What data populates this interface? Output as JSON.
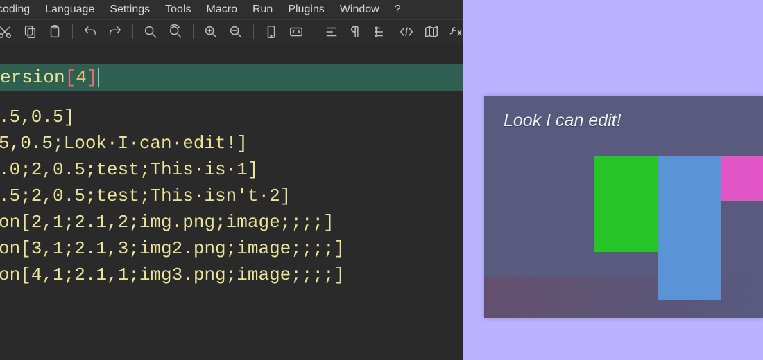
{
  "menubar": {
    "items": [
      "coding",
      "Language",
      "Settings",
      "Tools",
      "Macro",
      "Run",
      "Plugins",
      "Window",
      "?"
    ]
  },
  "toolbar": {
    "icons": [
      "cut",
      "copy",
      "paste",
      "undo",
      "redo",
      "search",
      "replace",
      "zoom-in",
      "zoom-out",
      "device",
      "code-block",
      "align",
      "pilcrow",
      "tree",
      "code",
      "map",
      "fx"
    ]
  },
  "highlight_line": {
    "prefix": "ersion",
    "lbracket": "[",
    "value": "4",
    "rbracket": "]"
  },
  "code_lines": [
    ".5,0.5]",
    "5,0.5;Look·I·can·edit!]",
    ".0;2,0.5;test;This·is·1]",
    ".5;2,0.5;test;This·isn't·2]",
    "on[2,1;2.1,2;img.png;image;;;;]",
    "on[3,1;2.1,3;img2.png;image;;;;]",
    "on[4,1;2.1,1;img3.png;image;;;;]"
  ],
  "preview": {
    "title": "Look I can edit!",
    "blocks": [
      {
        "name": "green"
      },
      {
        "name": "blue"
      },
      {
        "name": "pink"
      }
    ]
  }
}
